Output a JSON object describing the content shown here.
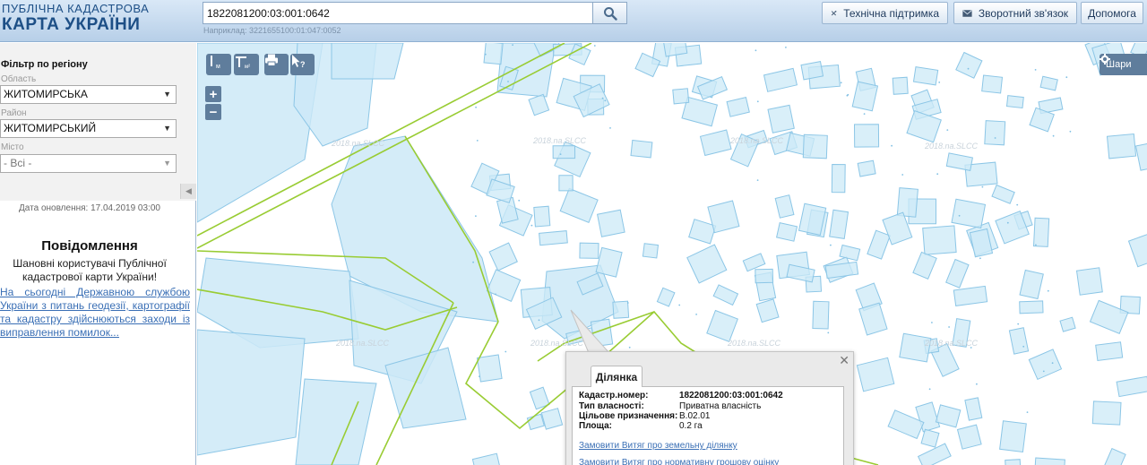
{
  "header": {
    "logo_line1": "ПУБЛІЧНА КАДАСТРОВА",
    "logo_line2": "КАРТА УКРАЇНИ",
    "search_value": "1822081200:03:001:0642",
    "search_hint": "Наприклад: 3221655100:01:047:0052",
    "buttons": {
      "support": "Технічна підтримка",
      "feedback": "Зворотний зв'язок",
      "help": "Допомога"
    }
  },
  "sidebar": {
    "filter_title": "Фільтр по регіону",
    "oblast_label": "Область",
    "oblast_value": "ЖИТОМИРСЬКА",
    "rayon_label": "Район",
    "rayon_value": "ЖИТОМИРСЬКИЙ",
    "misto_label": "Місто",
    "misto_value": "- Всі -",
    "update_date": "Дата оновлення: 17.04.2019 03:00",
    "notice_title": "Повідомлення",
    "notice_text": "Шановні користувачі Публічної кадастрової карти України!",
    "notice_link": "На сьогодні Державною службою України з питань геодезії, картографії та кадастру здійснюються заходи із виправлення помилок..."
  },
  "map": {
    "tools": {
      "ruler_sub": "м",
      "area_sub": "м²"
    },
    "zoom_in": "+",
    "zoom_out": "−",
    "layers_label": "Шари",
    "watermark": "2018.na.SLCC",
    "colors": {
      "parcel_fill": "#cce9f7",
      "parcel_stroke": "#8cc6e6",
      "boundary": "#99cc33",
      "toolbar": "#5f7d9c"
    }
  },
  "popup": {
    "tab": "Ділянка",
    "rows": [
      {
        "key": "Кадастр.номер:",
        "value": "1822081200:03:001:0642"
      },
      {
        "key": "Тип власності:",
        "value": "Приватна власність"
      },
      {
        "key": "Цільове призначення:",
        "value": "В.02.01"
      },
      {
        "key": "Площа:",
        "value": "0.2 га"
      }
    ],
    "link1": "Замовити Витяг про земельну ділянку",
    "link2": "Замовити Витяг про нормативну грошову оцінку"
  }
}
